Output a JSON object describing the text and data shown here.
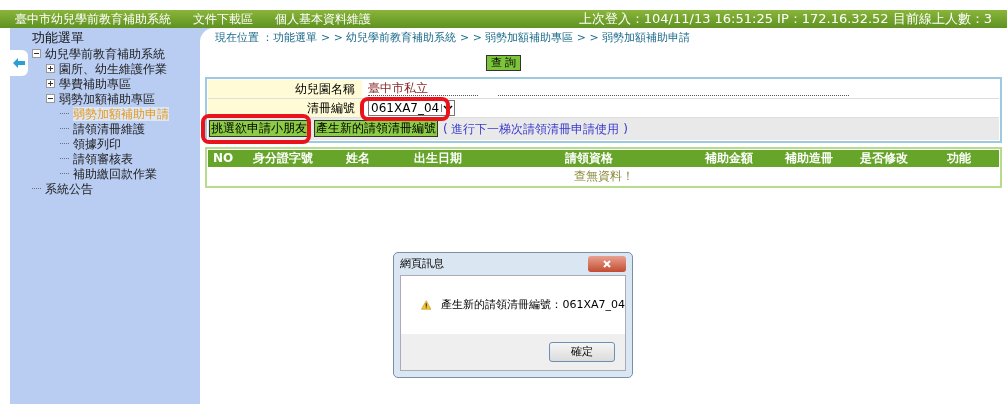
{
  "header": {
    "site_title": "臺中市幼兒學前教育補助系統",
    "menu": [
      "文件下載區",
      "個人基本資料維護"
    ],
    "login_info": "上次登入：104/11/13 16:51:25 IP：172.16.32.52 目前線上人數：3"
  },
  "sidebar": {
    "title": "功能選單",
    "tree": [
      {
        "label": "幼兒學前教育補助系統",
        "kind": "folder",
        "expanded": true,
        "selected": false,
        "children": [
          {
            "label": "園所、幼生維護作業",
            "kind": "folder",
            "expanded": false,
            "selected": false
          },
          {
            "label": "學費補助專區",
            "kind": "folder",
            "expanded": false,
            "selected": false
          },
          {
            "label": "弱勢加額補助專區",
            "kind": "folder",
            "expanded": true,
            "selected": false,
            "children": [
              {
                "label": "弱勢加額補助申請",
                "kind": "leaf",
                "selected": true
              },
              {
                "label": "請領清冊維護",
                "kind": "leaf",
                "selected": false
              },
              {
                "label": "領據列印",
                "kind": "leaf",
                "selected": false
              },
              {
                "label": "請領審核表",
                "kind": "leaf",
                "selected": false
              },
              {
                "label": "補助繳回款作業",
                "kind": "leaf",
                "selected": false
              }
            ]
          }
        ]
      },
      {
        "label": "系統公告",
        "kind": "leaf",
        "selected": false
      }
    ]
  },
  "breadcrumb": "現在位置 ：功能選單 > > 幼兒學前教育補助系統 > > 弱勢加額補助專區 > > 弱勢加額補助申請",
  "query_button": "查 詢",
  "form": {
    "fields": [
      {
        "label": "幼兒園名稱",
        "kind": "text",
        "value": "臺中市私立"
      },
      {
        "label": "清冊編號",
        "kind": "select",
        "value": "061XA7_04"
      }
    ],
    "buttons": [
      "挑選欲申請小朋友",
      "產生新的請領清冊編號"
    ],
    "note": "( 進行下一梯次請領清冊申請使用 )"
  },
  "table": {
    "columns": [
      "NO",
      "身分證字號",
      "姓名",
      "出生日期",
      "請領資格",
      "補助金額",
      "補助造冊",
      "是否修改",
      "功能"
    ],
    "empty_message": "查無資料！"
  },
  "dialog": {
    "title": "網頁訊息",
    "message": "產生新的請領清冊編號：061XA7_04",
    "ok_button": "確定"
  }
}
